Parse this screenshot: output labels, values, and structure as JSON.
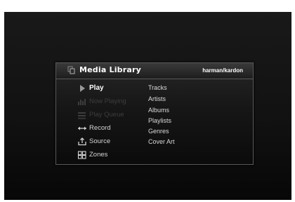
{
  "header": {
    "title": "Media Library",
    "brand": "harman/kardon",
    "icon": "library-icon"
  },
  "menu": [
    {
      "label": "Play",
      "icon": "play-icon",
      "state": "selected"
    },
    {
      "label": "Now Playing",
      "icon": "equalizer-icon",
      "state": "disabled"
    },
    {
      "label": "Play Queue",
      "icon": "queue-icon",
      "state": "disabled"
    },
    {
      "label": "Record",
      "icon": "record-icon",
      "state": "normal"
    },
    {
      "label": "Source",
      "icon": "source-icon",
      "state": "normal"
    },
    {
      "label": "Zones",
      "icon": "zones-icon",
      "state": "normal"
    }
  ],
  "submenu": [
    "Tracks",
    "Artists",
    "Albums",
    "Playlists",
    "Genres",
    "Cover Art"
  ],
  "colors": {
    "background": "#121212",
    "text": "#d4d4d4",
    "selected_text": "#ffffff",
    "disabled_text": "#3d3d3d"
  }
}
